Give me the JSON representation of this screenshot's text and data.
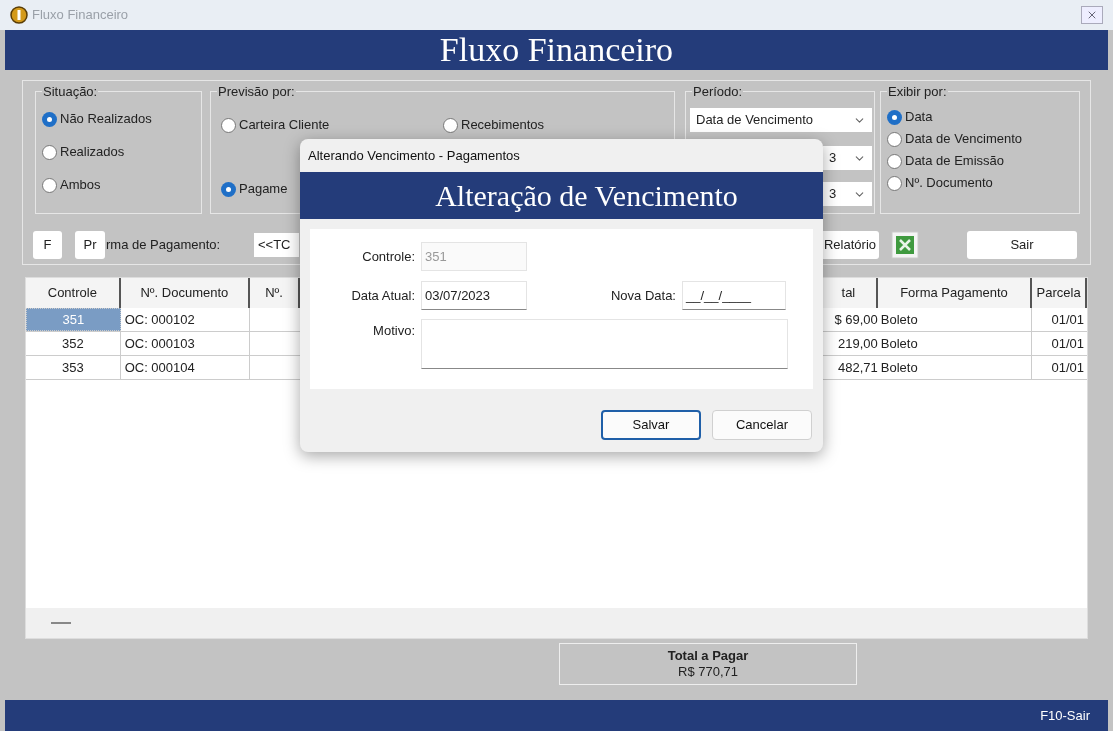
{
  "window": {
    "title": "Fluxo Financeiro",
    "banner": "Fluxo Financeiro"
  },
  "situacao": {
    "label": "Situação:",
    "options": [
      {
        "label": "Não Realizados",
        "selected": true
      },
      {
        "label": "Realizados",
        "selected": false
      },
      {
        "label": "Ambos",
        "selected": false
      }
    ]
  },
  "previsao": {
    "label": "Previsão por:",
    "options": [
      {
        "label": "Carteira Cliente",
        "selected": false
      },
      {
        "label": "Recebimentos",
        "selected": false
      },
      {
        "label": "Pagame",
        "selected": true
      }
    ]
  },
  "periodo": {
    "label": "Período:",
    "dropdowns": [
      "Data de Vencimento",
      "3",
      "3"
    ]
  },
  "exibir": {
    "label": "Exibir por:",
    "options": [
      {
        "label": "Data",
        "selected": true
      },
      {
        "label": "Data de Vencimento",
        "selected": false
      },
      {
        "label": "Data de Emissão",
        "selected": false
      },
      {
        "label": "Nº. Documento",
        "selected": false
      }
    ]
  },
  "toolbar": {
    "small_buttons": [
      "F",
      "Pr"
    ],
    "payment_label": "rma de Pagamento:",
    "payment_value": "<<TC",
    "report_button": "Relatório",
    "exit_button": "Sair"
  },
  "table": {
    "columns": [
      "Controle",
      "Nº. Documento",
      "Nº.",
      "tal",
      "Forma Pagamento",
      "Parcela"
    ],
    "rows": [
      {
        "controle": "351",
        "documento": "OC: 000102",
        "total": "$ 69,00",
        "forma": "Boleto",
        "parcela": "01/01",
        "selected": true
      },
      {
        "controle": "352",
        "documento": "OC: 000103",
        "total": "219,00",
        "forma": "Boleto",
        "parcela": "01/01",
        "selected": false
      },
      {
        "controle": "353",
        "documento": "OC: 000104",
        "total": "482,71",
        "forma": "Boleto",
        "parcela": "01/01",
        "selected": false
      }
    ]
  },
  "total": {
    "label": "Total a Pagar",
    "value": "R$ 770,71"
  },
  "status_bar": "F10-Sair",
  "dialog": {
    "title": "Alterando Vencimento - Pagamentos",
    "banner": "Alteração de Vencimento",
    "controle": {
      "label": "Controle:",
      "value": "351",
      "disabled": true
    },
    "data_atual": {
      "label": "Data Atual:",
      "value": "03/07/2023"
    },
    "nova_data": {
      "label": "Nova Data:",
      "value": "__/__/____"
    },
    "motivo": {
      "label": "Motivo:"
    },
    "buttons": [
      {
        "label": "Salvar",
        "focused": true
      },
      {
        "label": "Cancelar",
        "focused": false
      }
    ]
  }
}
